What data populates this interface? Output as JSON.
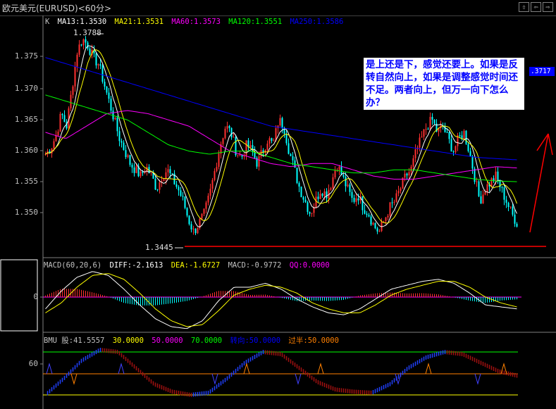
{
  "window": {
    "title": "欧元美元(EURUSD)<60分>",
    "buttons": [
      "⇧",
      "⇦",
      "⇨"
    ]
  },
  "colors": {
    "bg": "#000000",
    "up": "#ff3030",
    "down": "#00ffff",
    "ma13": "#ffffff",
    "ma21": "#ffff00",
    "ma60": "#ff00ff",
    "ma120": "#00ff00",
    "ma250": "#0000ff",
    "diff": "#ffffff",
    "dea": "#ffff00",
    "bar_up": "#ff3030",
    "bar_down": "#00ffff",
    "axis": "#808080",
    "red_line": "#ff0000"
  },
  "main_panel": {
    "indicator": "K",
    "legend": [
      {
        "label": "MA13:1.3530",
        "color": "#ffffff"
      },
      {
        "label": "MA21:1.3531",
        "color": "#ffff00"
      },
      {
        "label": "MA60:1.3573",
        "color": "#ff00ff"
      },
      {
        "label": "MA120:1.3551",
        "color": "#00ff00"
      },
      {
        "label": "MA250:1.3586",
        "color": "#0000ff"
      }
    ],
    "y_ticks": [
      "1.375",
      "1.370",
      "1.365",
      "1.360",
      "1.355",
      "1.350"
    ],
    "high_label": "1.3788",
    "low_label": "1.3445",
    "price_tag": ".3717",
    "annotation": "是上还是下，感觉还要上。如果是反转自然向上，如果是调整感觉时间还不足。两者向上，但万一向下怎么办？"
  },
  "macd_panel": {
    "legend": [
      {
        "label": "MACD(60,20,6)",
        "color": "#c0c0c0"
      },
      {
        "label": "DIFF:-2.1613",
        "color": "#ffffff"
      },
      {
        "label": "DEA:-1.6727",
        "color": "#ffff00"
      },
      {
        "label": "MACD:-0.9772",
        "color": "#c0c0c0"
      },
      {
        "label": "QQ:0.0000",
        "color": "#ff00ff"
      }
    ],
    "y_tick": "0"
  },
  "bmu_panel": {
    "legend": [
      {
        "label": "BMU 股:41.5557",
        "color": "#c0c0c0"
      },
      {
        "label": "30.0000",
        "color": "#ffff00"
      },
      {
        "label": "50.0000",
        "color": "#ff00ff"
      },
      {
        "label": "70.0000",
        "color": "#00ff00"
      },
      {
        "label": "转向:50.0000",
        "color": "#0000ff"
      },
      {
        "label": "过半:50.0000",
        "color": "#ff8000"
      }
    ],
    "y_tick": "60"
  },
  "chart_data": {
    "type": "candlestick",
    "price_range": [
      1.3445,
      1.3788
    ],
    "ylim": [
      1.3445,
      1.379
    ],
    "high": 1.3788,
    "low": 1.3445,
    "close_path": [
      1.3595,
      1.3605,
      1.3625,
      1.366,
      1.364,
      1.37,
      1.376,
      1.378,
      1.377,
      1.375,
      1.374,
      1.371,
      1.368,
      1.365,
      1.362,
      1.36,
      1.358,
      1.357,
      1.356,
      1.3575,
      1.356,
      1.354,
      1.356,
      1.357,
      1.3555,
      1.354,
      1.352,
      1.349,
      1.347,
      1.3485,
      1.35,
      1.353,
      1.357,
      1.361,
      1.364,
      1.363,
      1.36,
      1.359,
      1.361,
      1.36,
      1.358,
      1.36,
      1.362,
      1.361,
      1.365,
      1.364,
      1.36,
      1.357,
      1.354,
      1.352,
      1.35,
      1.352,
      1.354,
      1.353,
      1.355,
      1.358,
      1.356,
      1.354,
      1.352,
      1.353,
      1.351,
      1.35,
      1.348,
      1.347,
      1.349,
      1.351,
      1.352,
      1.354,
      1.356,
      1.357,
      1.36,
      1.362,
      1.364,
      1.365,
      1.363,
      1.364,
      1.362,
      1.36,
      1.362,
      1.363,
      1.36,
      1.356,
      1.352,
      1.354,
      1.355,
      1.356,
      1.354,
      1.352,
      1.35,
      1.3485
    ],
    "ma250_path": [
      1.375,
      1.374,
      1.373,
      1.372,
      1.371,
      1.37,
      1.369,
      1.368,
      1.367,
      1.366,
      1.365,
      1.364,
      1.3635,
      1.363,
      1.3625,
      1.362,
      1.3615,
      1.361,
      1.3605,
      1.36,
      1.3595,
      1.359,
      1.3588,
      1.3586
    ],
    "ma120_path": [
      1.369,
      1.368,
      1.367,
      1.366,
      1.365,
      1.363,
      1.361,
      1.36,
      1.3595,
      1.36,
      1.36,
      1.359,
      1.358,
      1.3575,
      1.357,
      1.3565,
      1.3565,
      1.357,
      1.357,
      1.3565,
      1.356,
      1.3555,
      1.3552,
      1.3551
    ],
    "ma60_path": [
      1.363,
      1.362,
      1.364,
      1.366,
      1.3665,
      1.366,
      1.365,
      1.364,
      1.362,
      1.36,
      1.359,
      1.358,
      1.3575,
      1.358,
      1.358,
      1.357,
      1.356,
      1.3555,
      1.3555,
      1.356,
      1.3565,
      1.357,
      1.3575,
      1.3573
    ]
  }
}
